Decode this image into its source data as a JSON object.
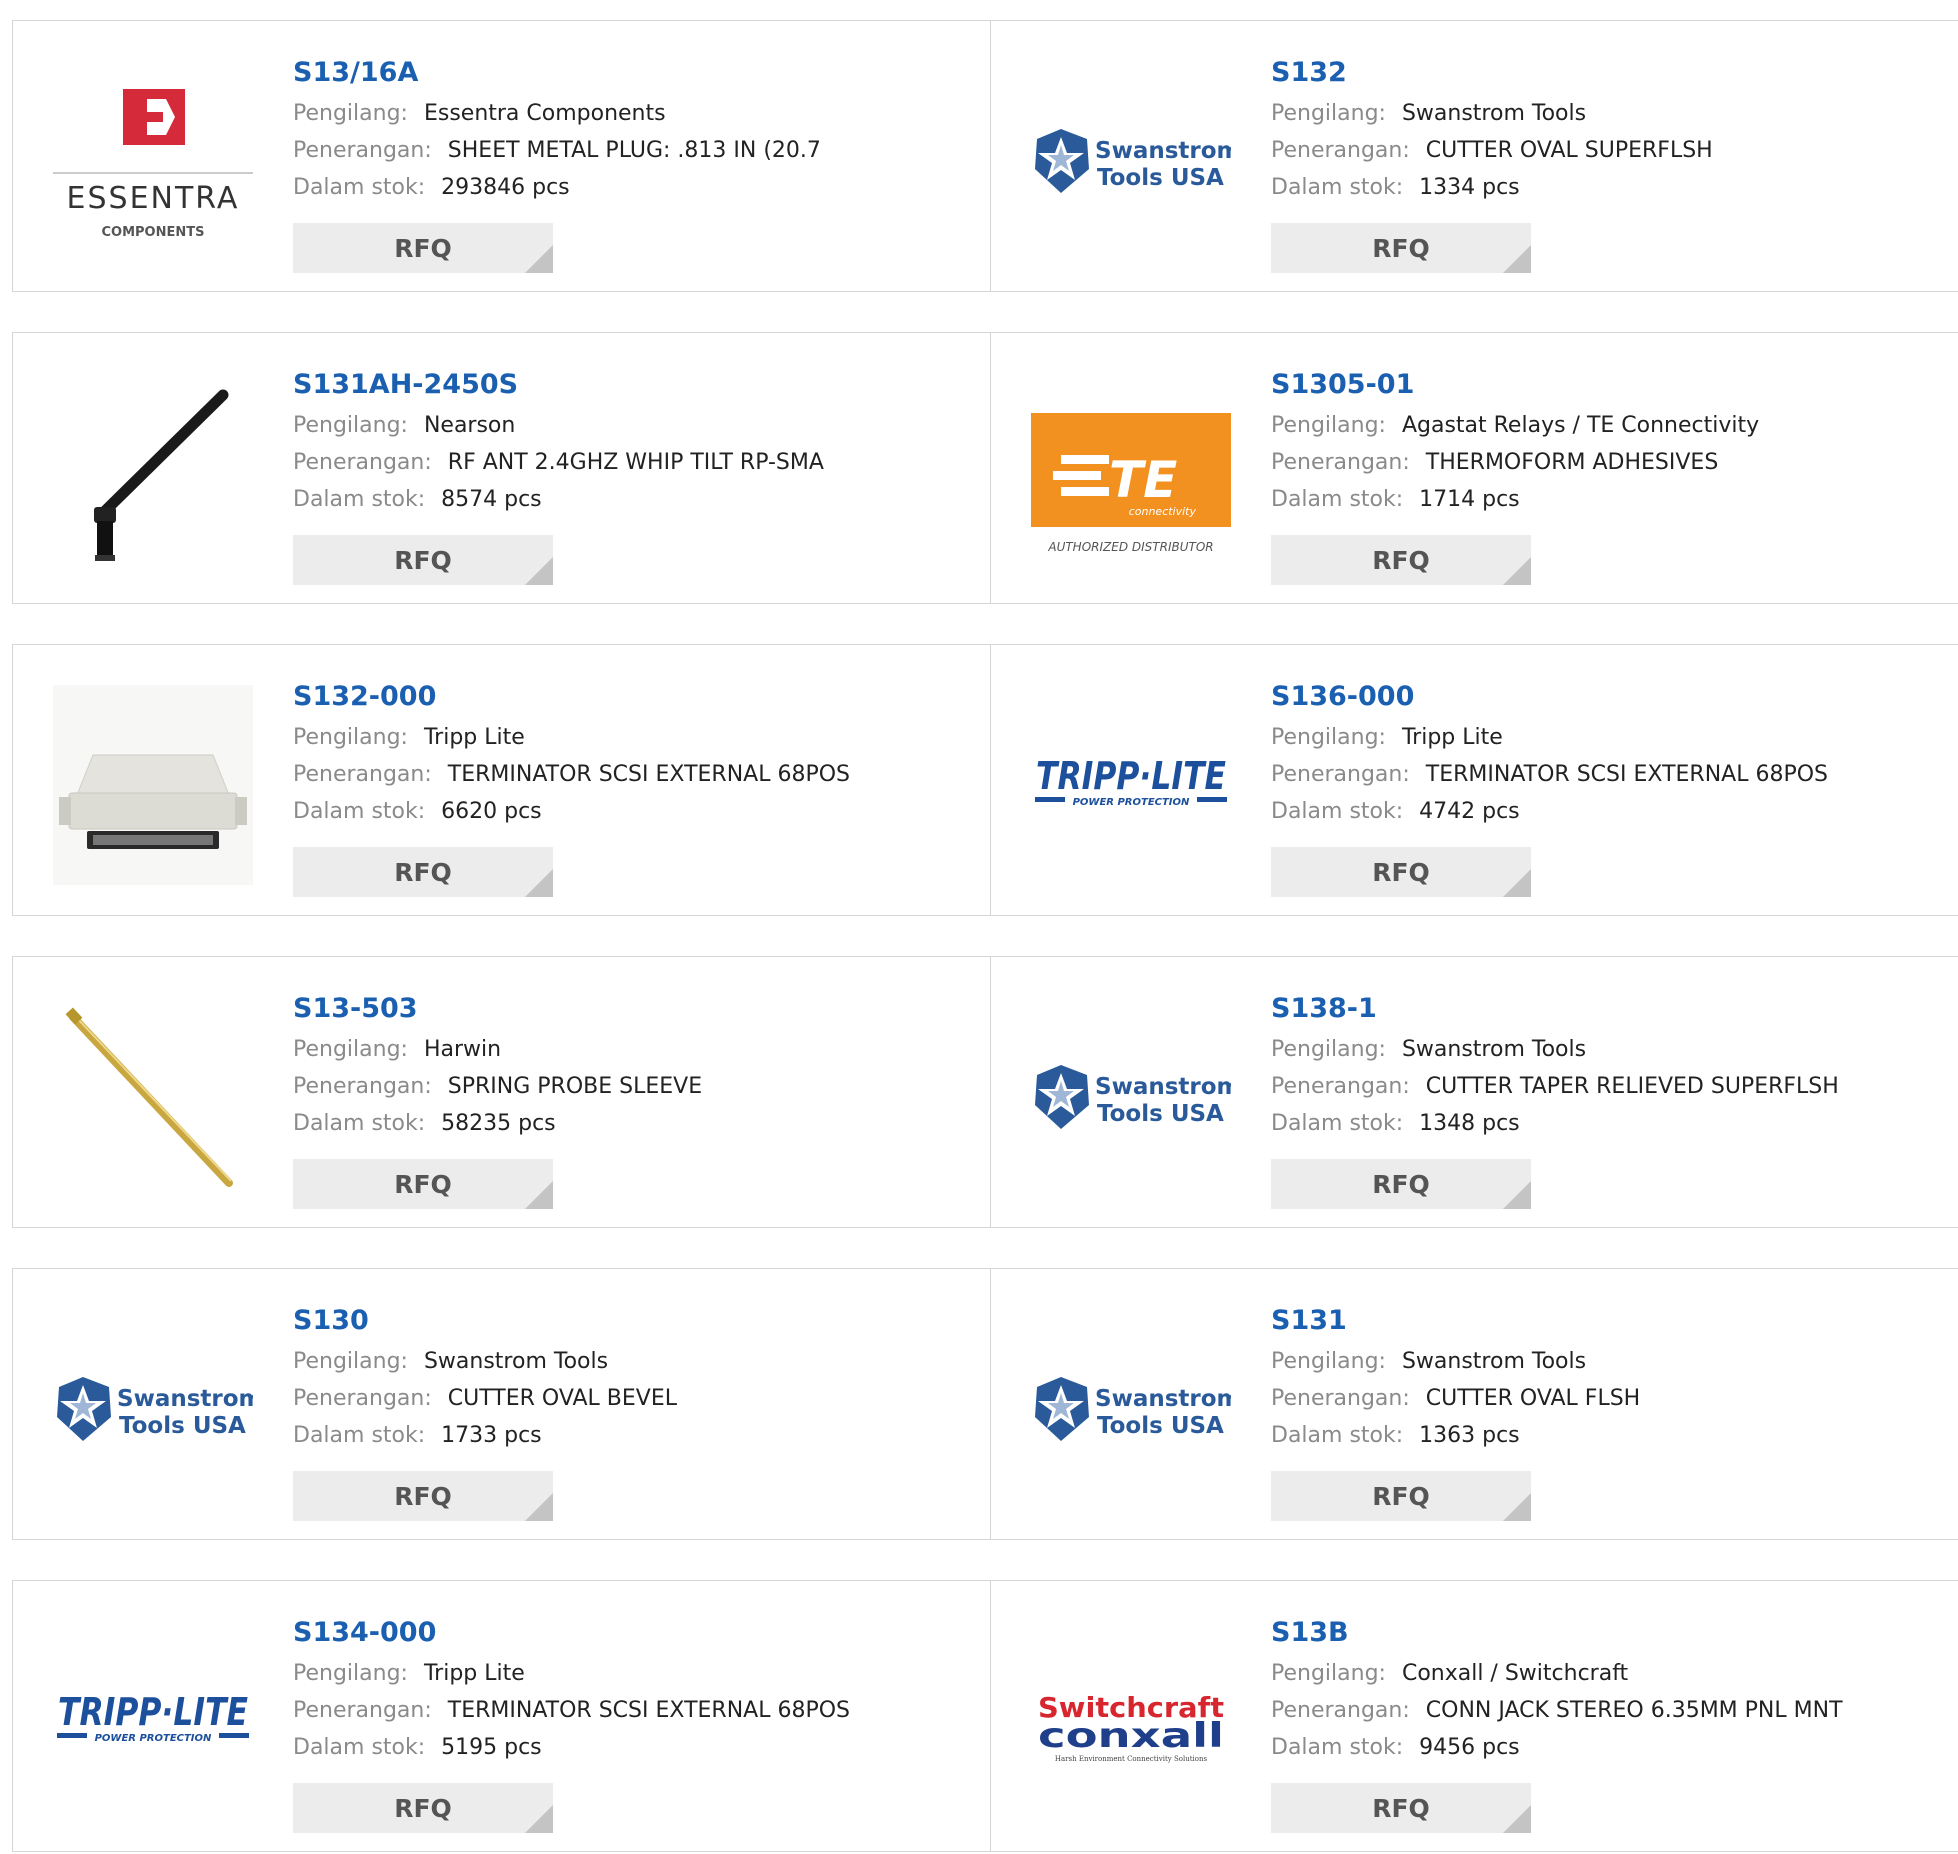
{
  "labels": {
    "manufacturer": "Pengilang:",
    "description": "Penerangan:",
    "stock": "Dalam stok:",
    "rfq": "RFQ"
  },
  "products": [
    {
      "part": "S13/16A",
      "manufacturer": "Essentra Components",
      "description": "SHEET METAL PLUG: .813 IN (20.7",
      "stock": "293846 pcs",
      "logo": "essentra",
      "logo_text": [
        "ESSENTRA",
        "COMPONENTS"
      ]
    },
    {
      "part": "S132",
      "manufacturer": "Swanstrom Tools",
      "description": "CUTTER OVAL SUPERFLSH",
      "stock": "1334 pcs",
      "logo": "swanstrom",
      "logo_text": [
        "Swanstrom",
        "Tools USA"
      ]
    },
    {
      "part": "S131AH-2450S",
      "manufacturer": "Nearson",
      "description": "RF ANT 2.4GHZ WHIP TILT RP-SMA",
      "stock": "8574 pcs",
      "logo": "antenna",
      "logo_text": []
    },
    {
      "part": "S1305-01",
      "manufacturer": "Agastat Relays / TE Connectivity",
      "description": "THERMOFORM ADHESIVES",
      "stock": "1714 pcs",
      "logo": "te",
      "logo_text": [
        "TE",
        "connectivity",
        "AUTHORIZED DISTRIBUTOR"
      ]
    },
    {
      "part": "S132-000",
      "manufacturer": "Tripp Lite",
      "description": "TERMINATOR SCSI EXTERNAL 68POS",
      "stock": "6620 pcs",
      "logo": "scsi",
      "logo_text": []
    },
    {
      "part": "S136-000",
      "manufacturer": "Tripp Lite",
      "description": "TERMINATOR SCSI EXTERNAL 68POS",
      "stock": "4742 pcs",
      "logo": "tripplite",
      "logo_text": [
        "TRIPP·LITE",
        "POWER PROTECTION"
      ]
    },
    {
      "part": "S13-503",
      "manufacturer": "Harwin",
      "description": "SPRING PROBE SLEEVE",
      "stock": "58235 pcs",
      "logo": "probe",
      "logo_text": []
    },
    {
      "part": "S138-1",
      "manufacturer": "Swanstrom Tools",
      "description": "CUTTER TAPER RELIEVED SUPERFLSH",
      "stock": "1348 pcs",
      "logo": "swanstrom",
      "logo_text": [
        "Swanstrom",
        "Tools USA"
      ]
    },
    {
      "part": "S130",
      "manufacturer": "Swanstrom Tools",
      "description": "CUTTER OVAL BEVEL",
      "stock": "1733 pcs",
      "logo": "swanstrom",
      "logo_text": [
        "Swanstrom",
        "Tools USA"
      ]
    },
    {
      "part": "S131",
      "manufacturer": "Swanstrom Tools",
      "description": "CUTTER OVAL FLSH",
      "stock": "1363 pcs",
      "logo": "swanstrom",
      "logo_text": [
        "Swanstrom",
        "Tools USA"
      ]
    },
    {
      "part": "S134-000",
      "manufacturer": "Tripp Lite",
      "description": "TERMINATOR SCSI EXTERNAL 68POS",
      "stock": "5195 pcs",
      "logo": "tripplite",
      "logo_text": [
        "TRIPP·LITE",
        "POWER PROTECTION"
      ]
    },
    {
      "part": "S13B",
      "manufacturer": "Conxall / Switchcraft",
      "description": "CONN JACK STEREO 6.35MM PNL MNT",
      "stock": "9456 pcs",
      "logo": "switchcraft",
      "logo_text": [
        "Switchcraft",
        "conxall",
        "Harsh Environment Connectivity Solutions"
      ]
    }
  ],
  "colors": {
    "part_link": "#1a5fb0",
    "label": "#8a8a8a",
    "value": "#222222",
    "essentra_red": "#d42a3a",
    "swanstrom_blue": "#2a5a9a",
    "te_orange": "#f39120",
    "tripplite_blue": "#1c4f9c",
    "switchcraft_red": "#d8262e",
    "switchcraft_blue": "#1f3f8a",
    "probe_gold": "#c9a740"
  }
}
